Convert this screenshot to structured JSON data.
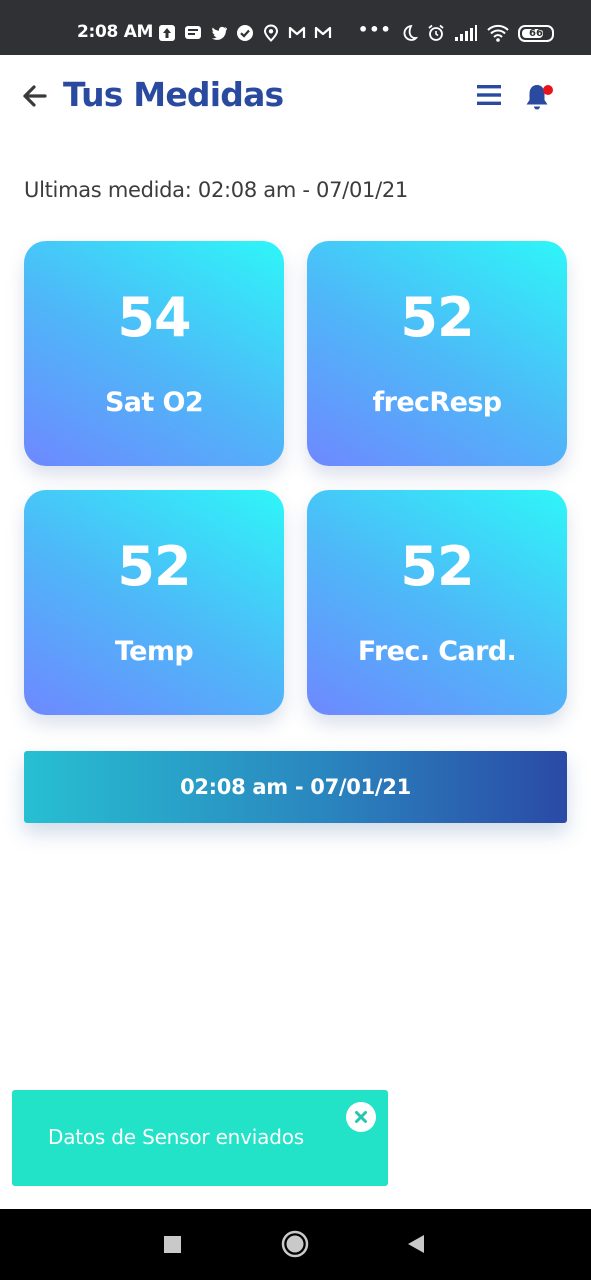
{
  "status_bar": {
    "time": "2:08 AM",
    "battery": "66",
    "overflow": "•••"
  },
  "header": {
    "title": "Tus Medidas",
    "title_color": "#2a4aa0"
  },
  "last_measure": "Ultimas medida: 02:08 am - 07/01/21",
  "cards": [
    {
      "value": "54",
      "label": "Sat O2"
    },
    {
      "value": "52",
      "label": "frecResp"
    },
    {
      "value": "52",
      "label": "Temp"
    },
    {
      "value": "52",
      "label": "Frec. Card."
    }
  ],
  "date_button": "02:08 am - 07/01/21",
  "toast": {
    "message": "Datos de Sensor enviados",
    "color": "#22e2c7"
  },
  "colors": {
    "card_gradient": [
      "#6e88ff",
      "#4eb8f8",
      "#2ef6f8"
    ],
    "button_gradient": [
      "#27bfd2",
      "#2a86bf",
      "#2a4aa6"
    ],
    "notification_dot": "#e8141c"
  }
}
